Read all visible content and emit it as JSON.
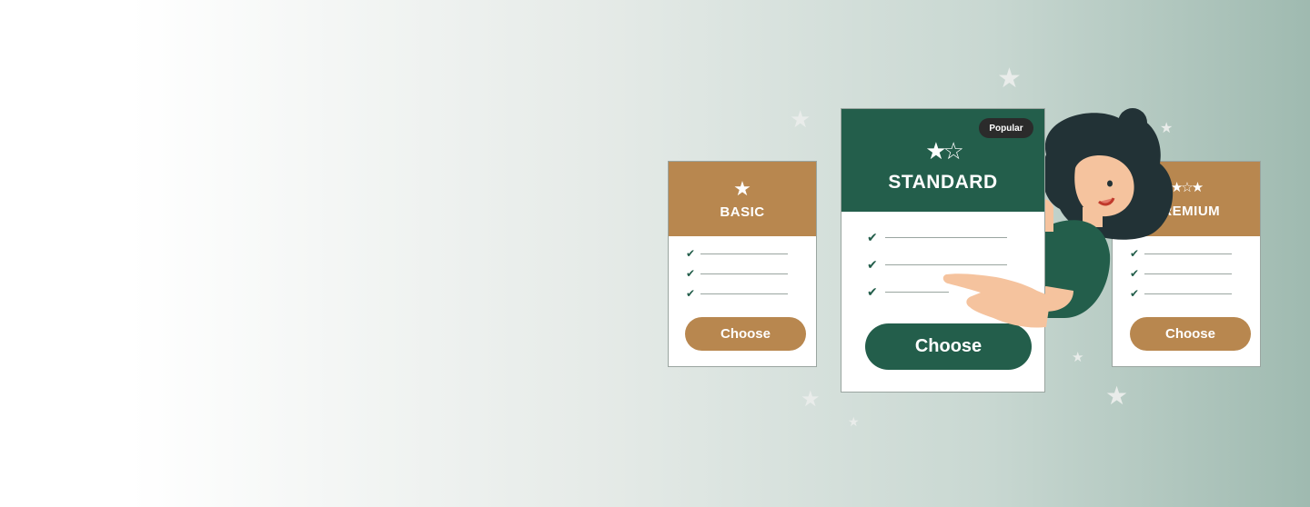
{
  "plans": {
    "basic": {
      "title": "BASIC",
      "cta": "Choose",
      "icon": "star-icon",
      "feature_count": 3
    },
    "standard": {
      "title": "STANDARD",
      "cta": "Choose",
      "badge": "Popular",
      "icon": "two-stars-icon",
      "feature_count": 3
    },
    "premium": {
      "title": "PREMIUM",
      "cta": "Choose",
      "icon": "three-stars-icon",
      "feature_count": 3
    }
  },
  "colors": {
    "gold": "#b8874f",
    "green": "#235e4b",
    "badge_dark": "#2b2b2b",
    "background_right": "#9fbab0"
  },
  "illustration": {
    "icon": "woman-pointing-illustration"
  }
}
